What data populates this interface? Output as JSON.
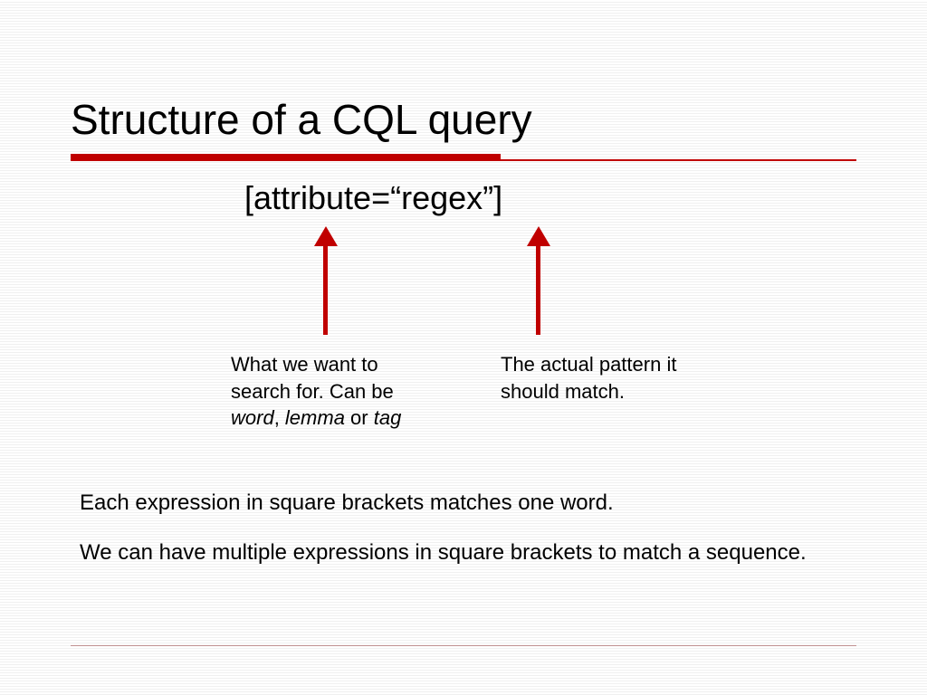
{
  "title": "Structure of a CQL query",
  "formula": "[attribute=“regex”]",
  "caption_left_line1": "What we want to",
  "caption_left_line2": "search for. Can be",
  "caption_left_word": "word",
  "caption_left_sep1": ", ",
  "caption_left_lemma": "lemma",
  "caption_left_sep2": " or ",
  "caption_left_tag": "tag",
  "caption_right_line1": "The actual pattern it",
  "caption_right_line2": "should match.",
  "note1": "Each expression in square brackets matches one word.",
  "note2": "We can have multiple expressions in square brackets to match a sequence."
}
